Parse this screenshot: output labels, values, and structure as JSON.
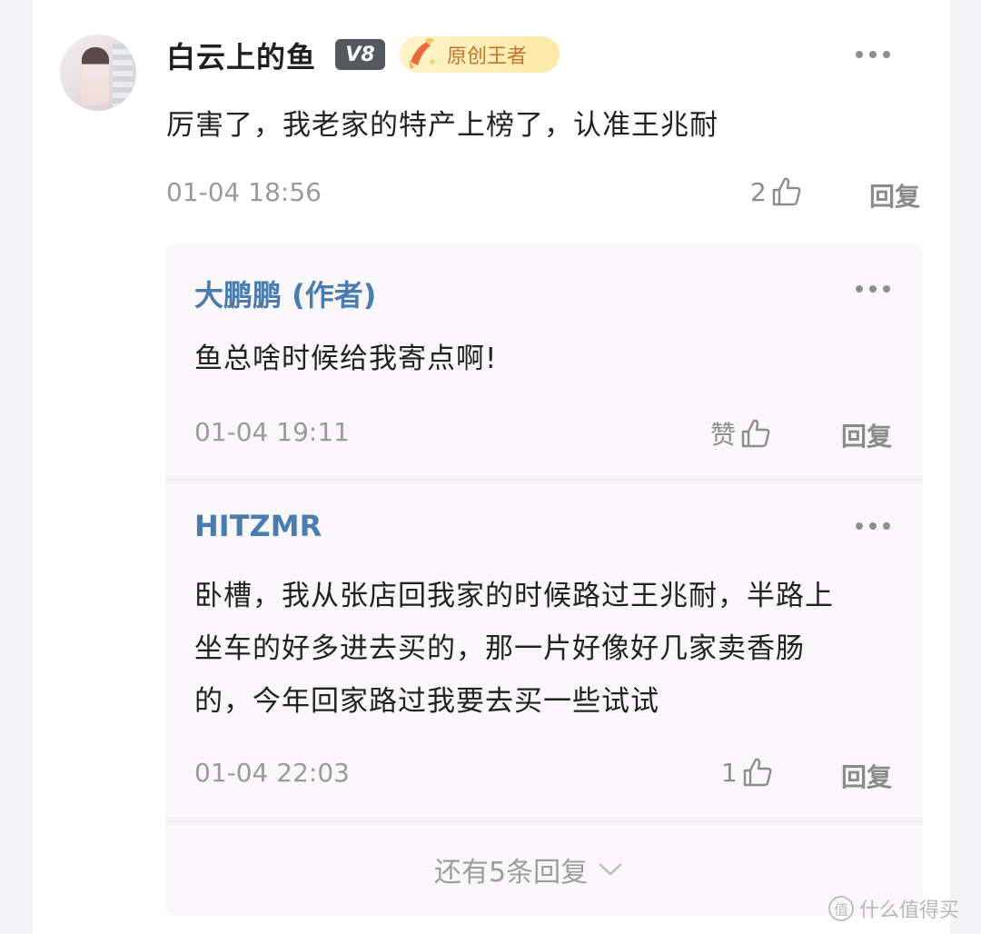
{
  "comment": {
    "username": "白云上的鱼",
    "level_badge": "V8",
    "title_badge": "原创王者",
    "content": "厉害了，我老家的特产上榜了，认准王兆耐",
    "time": "01-04 18:56",
    "likes": "2",
    "reply_label": "回复"
  },
  "replies": [
    {
      "author": "大鹏鹏 (作者)",
      "text_lines": [
        "鱼总啥时候给我寄点啊!"
      ],
      "time": "01-04 19:11",
      "likes": "赞",
      "reply_label": "回复"
    },
    {
      "author": "HITZMR",
      "text_lines": [
        "卧槽，我从张店回我家的时候路过王兆耐，半路上",
        "坐车的好多进去买的，那一片好像好几家卖香肠",
        "的，今年回家路过我要去买一些试试"
      ],
      "time": "01-04 22:03",
      "likes": "1",
      "reply_label": "回复"
    }
  ],
  "more_replies": "还有5条回复",
  "watermark": "什么值得买",
  "icons": {
    "like": "thumbs-up-icon",
    "more": "more-horizontal-icon",
    "expand": "chevron-down-icon",
    "badge_hand": "hand-pen-icon"
  }
}
